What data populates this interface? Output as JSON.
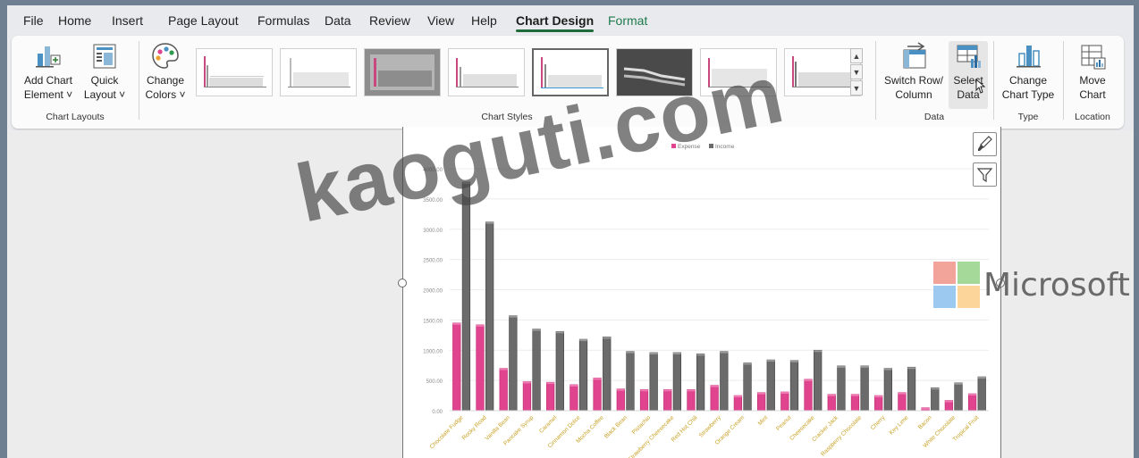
{
  "tabs": [
    {
      "label": "File"
    },
    {
      "label": "Home"
    },
    {
      "label": "Insert"
    },
    {
      "label": "Page Layout"
    },
    {
      "label": "Formulas"
    },
    {
      "label": "Data"
    },
    {
      "label": "Review"
    },
    {
      "label": "View"
    },
    {
      "label": "Help"
    },
    {
      "label": "Chart Design",
      "active": true
    },
    {
      "label": "Format"
    }
  ],
  "ribbon": {
    "chart_layouts": {
      "group_label": "Chart Layouts",
      "add_chart_element": {
        "line1": "Add Chart",
        "line2": "Element ˅",
        "icon": "add-chart-element-icon"
      },
      "quick_layout": {
        "line1": "Quick",
        "line2": "Layout ˅",
        "icon": "quick-layout-icon"
      }
    },
    "change_colors": {
      "line1": "Change",
      "line2": "Colors ˅",
      "icon": "palette-icon"
    },
    "chart_styles": {
      "group_label": "Chart Styles",
      "count": 8,
      "selected_index": 4
    },
    "data": {
      "group_label": "Data",
      "switch_row_column": {
        "line1": "Switch Row/",
        "line2": "Column",
        "icon": "switch-row-column-icon"
      },
      "select_data": {
        "line1": "Select",
        "line2": "Data",
        "icon": "select-data-icon"
      }
    },
    "type": {
      "group_label": "Type",
      "change_chart_type": {
        "line1": "Change",
        "line2": "Chart Type",
        "icon": "change-chart-type-icon"
      }
    },
    "location": {
      "group_label": "Location",
      "move_chart": {
        "line1": "Move",
        "line2": "Chart",
        "icon": "move-chart-icon"
      }
    }
  },
  "colors": {
    "expense": "#e0448f",
    "income": "#6b6b6b",
    "category_label": "#c9a227",
    "accent_tab": "#1f6b3a",
    "format_tab": "#1f7a4d"
  },
  "watermark": "kaoguti.com",
  "brand": "Microsoft",
  "chart_data": {
    "type": "bar",
    "legend": {
      "position": "top"
    },
    "series": [
      {
        "name": "Expense",
        "values": [
          1450,
          1420,
          700,
          480,
          470,
          430,
          540,
          360,
          350,
          350,
          350,
          420,
          250,
          300,
          310,
          520,
          270,
          270,
          250,
          300,
          50,
          170,
          280
        ]
      },
      {
        "name": "Income",
        "values": [
          3780,
          3120,
          1570,
          1350,
          1310,
          1180,
          1220,
          980,
          960,
          960,
          940,
          980,
          790,
          840,
          830,
          1000,
          740,
          740,
          700,
          720,
          380,
          460,
          560
        ]
      }
    ],
    "categories": [
      "Chocolate Fudge",
      "Rocky Road",
      "Vanilla Bean",
      "Pancake Syrup",
      "Caramel",
      "Cinnamon Dolce",
      "Mocha Coffee",
      "Black Bean",
      "Pistachio",
      "Strawberry Cheesecake",
      "Red Hot Chili",
      "Strawberry",
      "Orange Cream",
      "Mint",
      "Peanut",
      "Cheesecake",
      "Cracker Jack",
      "Raspberry Chocolate",
      "Cherry",
      "Key Lime",
      "Bacon",
      "White Chocolate",
      "Tropical Fruit"
    ],
    "y_ticks": [
      "0.00",
      "500.00",
      "1000.00",
      "1500.00",
      "2000.00",
      "2500.00",
      "3000.00",
      "3500.00",
      "4000.00"
    ],
    "ylim": [
      0,
      4000
    ],
    "grid": true
  }
}
